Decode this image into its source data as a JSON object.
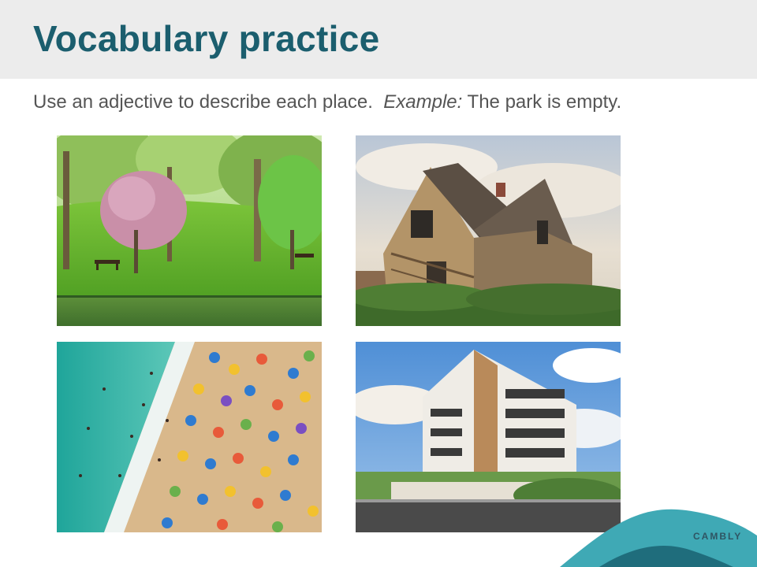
{
  "slide": {
    "title": "Vocabulary practice",
    "instruction": {
      "lead": "Use an adjective to describe each place.",
      "example_label": "Example:",
      "example_text": "The park is empty."
    },
    "photos": [
      {
        "subject": "park",
        "icon": "park-photo"
      },
      {
        "subject": "old house",
        "icon": "old-house-photo"
      },
      {
        "subject": "beach",
        "icon": "crowded-beach-photo"
      },
      {
        "subject": "apartment building",
        "icon": "apartment-building-photo"
      }
    ],
    "brand": "CAMBLY"
  },
  "colors": {
    "title": "#1b5e6e",
    "header_band": "#ececec",
    "body_text": "#555555",
    "brand_teal": "#3fa9b5",
    "brand_dark": "#1f6d7c"
  }
}
